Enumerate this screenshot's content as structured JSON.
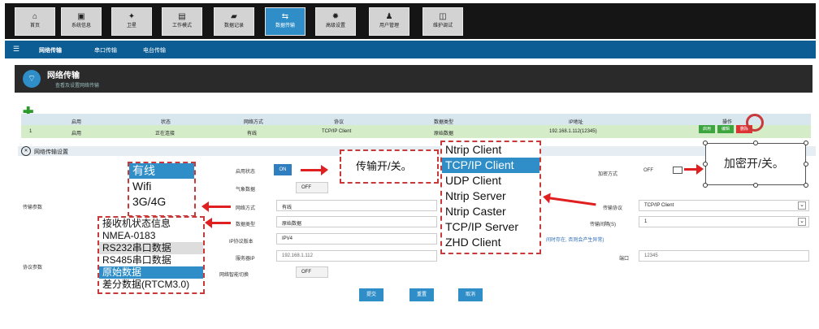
{
  "nav": {
    "items": [
      {
        "icon": "⌂",
        "label": "首页"
      },
      {
        "icon": "▣",
        "label": "系统信息"
      },
      {
        "icon": "✦",
        "label": "卫星"
      },
      {
        "icon": "▤",
        "label": "工作模式"
      },
      {
        "icon": "▰",
        "label": "数据记录"
      },
      {
        "icon": "⇆",
        "label": "数据传输"
      },
      {
        "icon": "✹",
        "label": "高级设置"
      },
      {
        "icon": "♟",
        "label": "用户管理"
      },
      {
        "icon": "◫",
        "label": "维护调试"
      }
    ]
  },
  "subnav": {
    "items": [
      "网络传输",
      "串口传输",
      "电台传输"
    ]
  },
  "header": {
    "title": "网络传输",
    "subtitle": "查看及设置网络传输"
  },
  "table": {
    "headers": [
      "启用",
      "状态",
      "网络方式",
      "协议",
      "数据类型",
      "IP地址",
      "操作"
    ],
    "row": {
      "index": "1",
      "enable": "启用",
      "status": "正在连接",
      "network": "有线",
      "protocol": "TCP/IP Client",
      "data_type": "原始数据",
      "ip": "192.168.1.112(12345)"
    },
    "actions": [
      "启用",
      "编辑",
      "删除"
    ]
  },
  "section": {
    "title": "网络传输设置"
  },
  "form": {
    "group_transfer": "传输参数",
    "group_protocol": "协议参数",
    "enable_label": "启用状态",
    "enable_on": "ON",
    "weather_label": "气象数据",
    "weather_off": "OFF",
    "network_label": "网络方式",
    "network_value": "有线",
    "datatype_label": "数据类型",
    "datatype_value": "原始数据",
    "ipver_label": "IP协议版本",
    "ipver_value": "IPV4",
    "server_label": "服务器IP",
    "server_value": "192.168.1.112",
    "smart_label": "网络智能切换",
    "smart_off": "OFF",
    "encrypt_label": "加密方式",
    "encrypt_off": "OFF",
    "protocol_label": "传输协议",
    "protocol_value": "TCP/IP Client",
    "cycle_label": "传输间隔(S)",
    "cycle_value": "1",
    "note": "间时存在, 否则会产生异常)",
    "port_label": "端口",
    "port_value": "12345"
  },
  "buttons": {
    "submit": "提交",
    "reset": "重置",
    "cancel": "取消"
  },
  "annotations": {
    "network_options": [
      "有线",
      "Wifi",
      "3G/4G"
    ],
    "data_options": [
      "接收机状态信息",
      "NMEA-0183",
      "RS232串口数据",
      "RS485串口数据",
      "原始数据",
      "差分数据(RTCM3.0)"
    ],
    "protocol_options": [
      "Ntrip Client",
      "TCP/IP Client",
      "UDP Client",
      "Ntrip Server",
      "Ntrip Caster",
      "TCP/IP Server",
      "ZHD Client"
    ],
    "transfer_toggle": "传输开/关。",
    "encrypt_toggle": "加密开/关。"
  },
  "colors": {
    "accent": "#2f8ec8",
    "annotation": "#e02020",
    "topbar": "#151515",
    "subbar": "#0c5d94"
  }
}
